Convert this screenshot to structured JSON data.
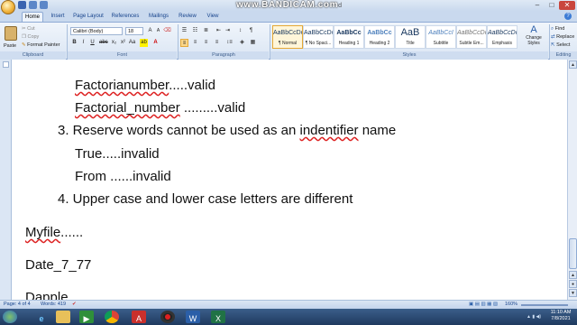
{
  "watermark": {
    "text": "www.BANDICAM.com",
    "suffix": "d"
  },
  "tabs": [
    "Home",
    "Insert",
    "Page Layout",
    "References",
    "Mailings",
    "Review",
    "View"
  ],
  "clipboard": {
    "paste": "Paste",
    "cut": "Cut",
    "copy": "Copy",
    "format_painter": "Format Painter",
    "label": "Clipboard"
  },
  "font": {
    "name": "Calibri (Body)",
    "size": "18",
    "label": "Font"
  },
  "paragraph": {
    "label": "Paragraph"
  },
  "styles": {
    "items": [
      {
        "sample": "AaBbCcDc",
        "name": "¶ Normal"
      },
      {
        "sample": "AaBbCcDc",
        "name": "¶ No Spaci..."
      },
      {
        "sample": "AaBbCc",
        "name": "Heading 1"
      },
      {
        "sample": "AaBbCc",
        "name": "Heading 2"
      },
      {
        "sample": "AaB",
        "name": "Title"
      },
      {
        "sample": "AaBbCcI",
        "name": "Subtitle"
      },
      {
        "sample": "AaBbCcDc",
        "name": "Subtle Em..."
      },
      {
        "sample": "AaBbCcDc",
        "name": "Emphasis"
      }
    ],
    "change_styles": "Change Styles",
    "label": "Styles"
  },
  "editing": {
    "find": "Find",
    "replace": "Replace",
    "select": "Select",
    "label": "Editing"
  },
  "document": {
    "lines": [
      {
        "pre": "",
        "sq": "Factorianumber",
        "post": ".....valid"
      },
      {
        "pre": "",
        "sq": "Factorial_number",
        "post": " .........valid"
      },
      {
        "pre": "3. Reserve words cannot be used as an ",
        "sq": "indentifier",
        "post": " name"
      },
      {
        "pre": "True.....invalid",
        "sq": "",
        "post": ""
      },
      {
        "pre": "From ......invalid",
        "sq": "",
        "post": ""
      },
      {
        "pre": "4. Upper case and lower case letters are different",
        "sq": "",
        "post": ""
      },
      {
        "pre": "",
        "sq": "Myfile",
        "post": "......"
      },
      {
        "pre": "Date_7_77",
        "sq": "",
        "post": ""
      },
      {
        "pre": "Dapple",
        "sq": "",
        "post": ""
      }
    ]
  },
  "status": {
    "page": "Page: 4 of 4",
    "words": "Words: 419",
    "zoom": "160%"
  },
  "clock": {
    "time": "11:10 AM",
    "date": "7/8/2021"
  },
  "icons": [
    "office-button",
    "save-icon",
    "undo-icon",
    "redo-icon",
    "paste-icon",
    "find-icon",
    "replace-icon",
    "select-icon",
    "start-icon",
    "ie-icon",
    "explorer-icon",
    "media-icon",
    "chrome-icon",
    "acrobat-icon",
    "record-icon",
    "word-icon",
    "excel-icon"
  ],
  "colors": {
    "ribbon": "#dbe6f4",
    "accent": "#15428b",
    "taskbar": "#1f3a5f"
  }
}
